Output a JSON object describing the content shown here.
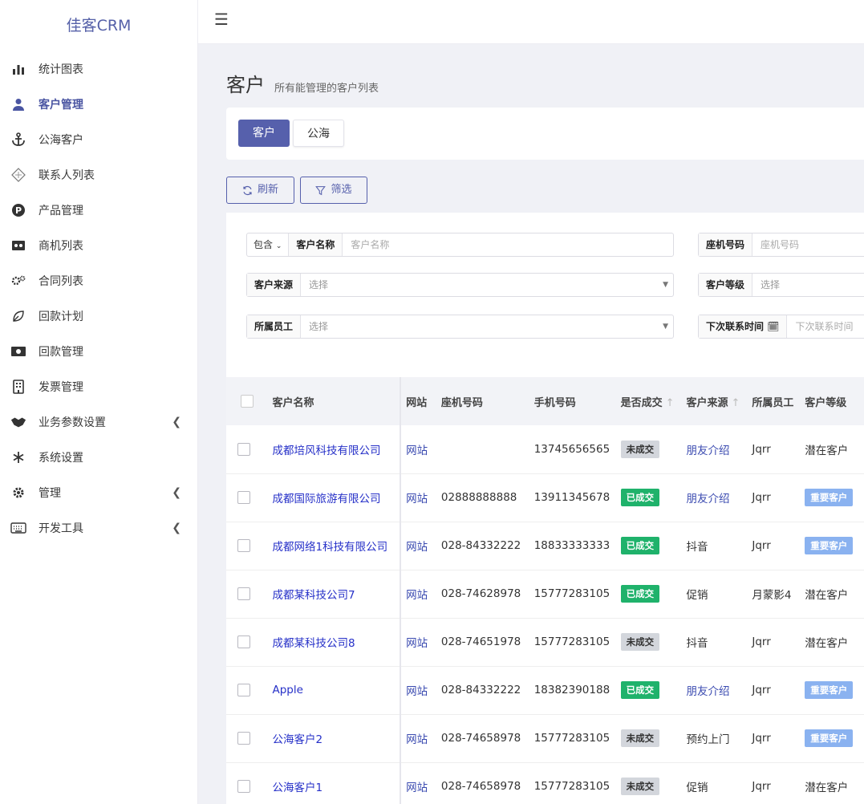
{
  "brand": "佳客CRM",
  "sidebar": {
    "items": [
      {
        "label": "统计图表",
        "icon": "bar-chart-icon"
      },
      {
        "label": "客户管理",
        "icon": "user-icon"
      },
      {
        "label": "公海客户",
        "icon": "anchor-icon"
      },
      {
        "label": "联系人列表",
        "icon": "contacts-icon"
      },
      {
        "label": "产品管理",
        "icon": "product-icon"
      },
      {
        "label": "商机列表",
        "icon": "opportunity-icon"
      },
      {
        "label": "合同列表",
        "icon": "gears-icon"
      },
      {
        "label": "回款计划",
        "icon": "leaf-icon"
      },
      {
        "label": "回款管理",
        "icon": "money-icon"
      },
      {
        "label": "发票管理",
        "icon": "building-icon"
      },
      {
        "label": "业务参数设置",
        "icon": "handshake-icon"
      },
      {
        "label": "系统设置",
        "icon": "asterisk-icon"
      },
      {
        "label": "管理",
        "icon": "gear-icon"
      },
      {
        "label": "开发工具",
        "icon": "keyboard-icon"
      }
    ],
    "active_index": 1
  },
  "page": {
    "title": "客户",
    "subtitle": "所有能管理的客户列表"
  },
  "tabs": [
    "客户",
    "公海"
  ],
  "actions": {
    "refresh": "刷新",
    "filter": "筛选"
  },
  "filters": {
    "name_op": "包含",
    "name_label": "客户名称",
    "name_placeholder": "客户名称",
    "phone_label": "座机号码",
    "phone_placeholder": "座机号码",
    "source_label": "客户来源",
    "source_placeholder": "选择",
    "level_label": "客户等级",
    "level_placeholder": "选择",
    "staff_label": "所属员工",
    "staff_placeholder": "选择",
    "next_label": "下次联系时间",
    "next_placeholder": "下次联系时间"
  },
  "table": {
    "headers": [
      "客户名称",
      "网站",
      "座机号码",
      "手机号码",
      "是否成交",
      "客户来源",
      "所属员工",
      "客户等级"
    ],
    "rows": [
      {
        "name": "成都培风科技有限公司",
        "site": "网站",
        "phone": "",
        "mobile": "13745656565",
        "deal": "未成交",
        "deal_status": "no",
        "source": "朋友介绍",
        "source_link": true,
        "staff": "Jqrr",
        "level": "潜在客户",
        "level_vip": false
      },
      {
        "name": "成都国际旅游有限公司",
        "site": "网站",
        "phone": "02888888888",
        "mobile": "13911345678",
        "deal": "已成交",
        "deal_status": "yes",
        "source": "朋友介绍",
        "source_link": true,
        "staff": "Jqrr",
        "level": "重要客户",
        "level_vip": true
      },
      {
        "name": "成都网络1科技有限公司",
        "site": "网站",
        "phone": "028-84332222",
        "mobile": "18833333333",
        "deal": "已成交",
        "deal_status": "yes",
        "source": "抖音",
        "source_link": false,
        "staff": "Jqrr",
        "level": "重要客户",
        "level_vip": true
      },
      {
        "name": "成都某科技公司7",
        "site": "网站",
        "phone": "028-74628978",
        "mobile": "15777283105",
        "deal": "已成交",
        "deal_status": "yes",
        "source": "促销",
        "source_link": false,
        "staff": "月蒙影4",
        "level": "潜在客户",
        "level_vip": false
      },
      {
        "name": "成都某科技公司8",
        "site": "网站",
        "phone": "028-74651978",
        "mobile": "15777283105",
        "deal": "未成交",
        "deal_status": "no",
        "source": "抖音",
        "source_link": false,
        "staff": "Jqrr",
        "level": "潜在客户",
        "level_vip": false
      },
      {
        "name": "Apple",
        "site": "网站",
        "phone": "028-84332222",
        "mobile": "18382390188",
        "deal": "已成交",
        "deal_status": "yes",
        "source": "朋友介绍",
        "source_link": true,
        "staff": "Jqrr",
        "level": "重要客户",
        "level_vip": true
      },
      {
        "name": "公海客户2",
        "site": "网站",
        "phone": "028-74658978",
        "mobile": "15777283105",
        "deal": "未成交",
        "deal_status": "no",
        "source": "预约上门",
        "source_link": false,
        "staff": "Jqrr",
        "level": "重要客户",
        "level_vip": true
      },
      {
        "name": "公海客户1",
        "site": "网站",
        "phone": "028-74658978",
        "mobile": "15777283105",
        "deal": "未成交",
        "deal_status": "no",
        "source": "促销",
        "source_link": false,
        "staff": "Jqrr",
        "level": "潜在客户",
        "level_vip": false
      }
    ]
  },
  "colors": {
    "primary": "#5660ac",
    "link": "#2630c8",
    "deal_yes": "#1fb26b",
    "deal_no": "#d3d6dc",
    "vip": "#8ab2f0"
  }
}
